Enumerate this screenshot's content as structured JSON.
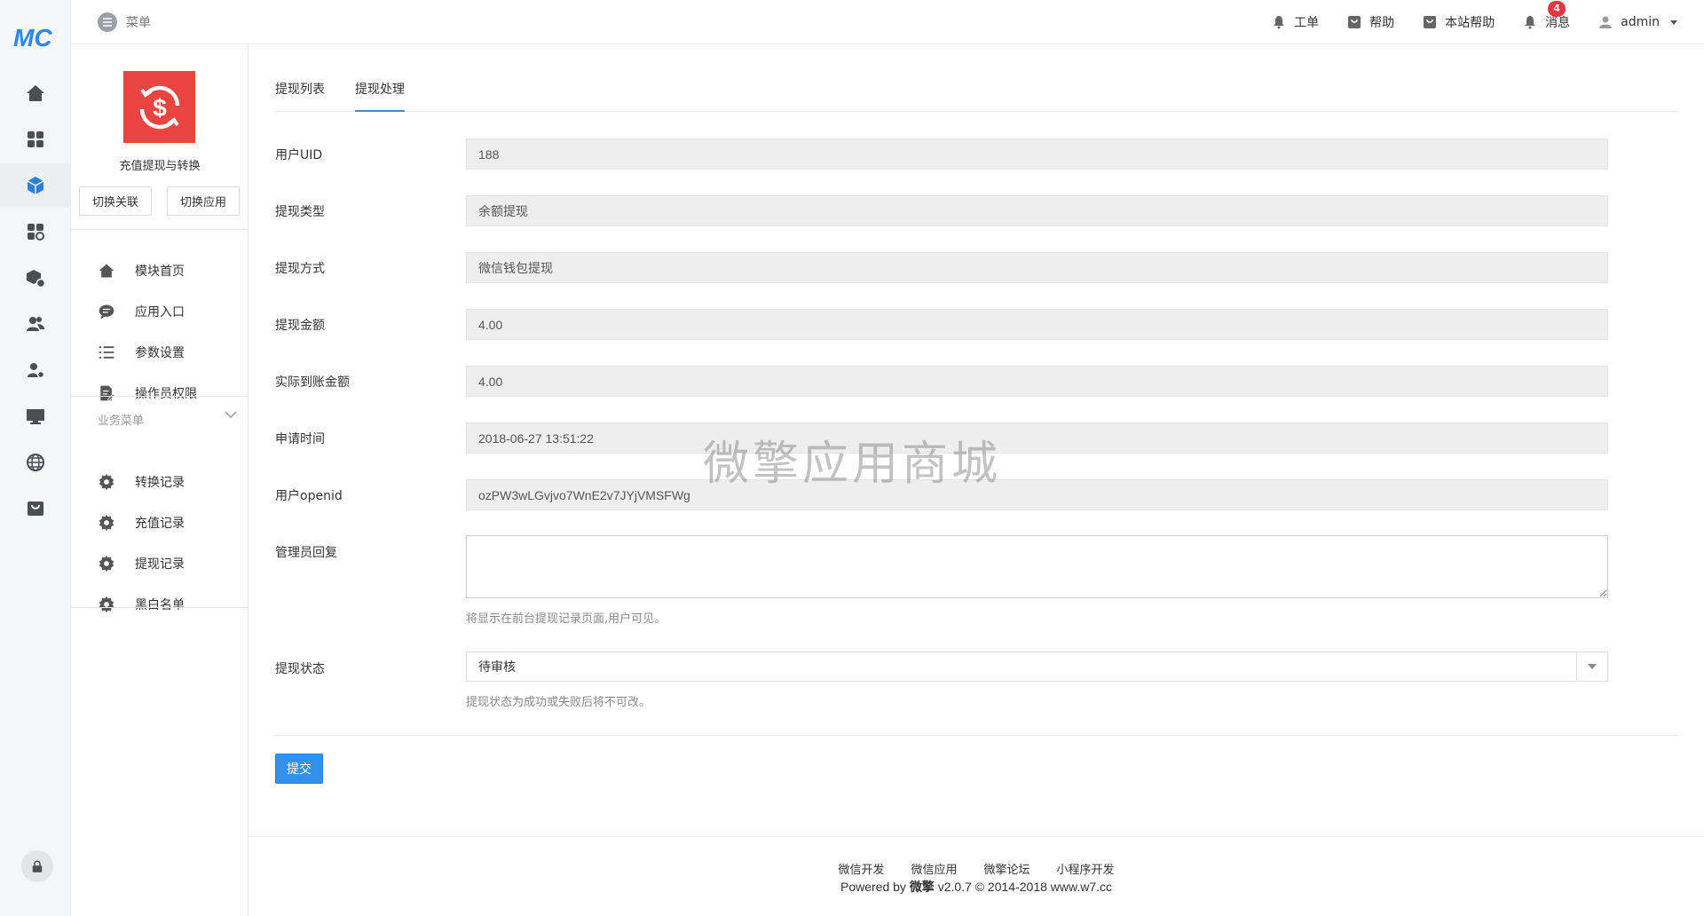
{
  "topbar": {
    "menu_label": "菜单",
    "links": [
      {
        "label": "工单",
        "icon": "bell-icon"
      },
      {
        "label": "帮助",
        "icon": "help-box-icon"
      },
      {
        "label": "本站帮助",
        "icon": "help-box-icon"
      },
      {
        "label": "消息",
        "icon": "bell-icon",
        "badge": "4"
      }
    ],
    "user": "admin"
  },
  "rail": {
    "items": [
      "home-icon",
      "grid-icon",
      "cube-icon",
      "apps-icon",
      "cube-gear-icon",
      "users-icon",
      "user-gear-icon",
      "monitor-icon",
      "globe-icon",
      "shop-icon"
    ],
    "active_index": 2
  },
  "sidebar": {
    "app_name": "充值提现与转换",
    "switch_link": "切换关联",
    "switch_app": "切换应用",
    "items": [
      {
        "label": "模块首页",
        "icon": "home-icon"
      },
      {
        "label": "应用入口",
        "icon": "chat-icon"
      },
      {
        "label": "参数设置",
        "icon": "list-icon"
      },
      {
        "label": "操作员权限",
        "icon": "edit-doc-icon"
      }
    ],
    "group_label": "业务菜单",
    "group_items": [
      {
        "label": "转换记录",
        "icon": "gear-icon"
      },
      {
        "label": "充值记录",
        "icon": "gear-icon"
      },
      {
        "label": "提现记录",
        "icon": "gear-icon"
      },
      {
        "label": "黑白名单",
        "icon": "gear-icon"
      }
    ]
  },
  "tabs": [
    {
      "label": "提现列表",
      "active": false
    },
    {
      "label": "提现处理",
      "active": true
    }
  ],
  "form": {
    "fields": [
      {
        "label": "用户UID",
        "value": "188"
      },
      {
        "label": "提现类型",
        "value": "余额提现"
      },
      {
        "label": "提现方式",
        "value": "微信钱包提现"
      },
      {
        "label": "提现金额",
        "value": "4.00"
      },
      {
        "label": "实际到账金额",
        "value": "4.00"
      },
      {
        "label": "申请时间",
        "value": "2018-06-27 13:51:22"
      },
      {
        "label": "用户openid",
        "value": "ozPW3wLGvjvo7WnE2v7JYjVMSFWg"
      }
    ],
    "reply_label": "管理员回复",
    "reply_value": "",
    "reply_help": "将显示在前台提现记录页面,用户可见。",
    "status_label": "提现状态",
    "status_value": "待审核",
    "status_help": "提现状态为成功或失败后将不可改。",
    "submit": "提交"
  },
  "watermark": "微擎应用商城",
  "footer": {
    "links": [
      "微信开发",
      "微信应用",
      "微擎论坛",
      "小程序开发"
    ],
    "powered_prefix": "Powered by",
    "brand": "微擎",
    "powered_suffix": "v2.0.7 © 2014-2018 www.w7.cc"
  },
  "colors": {
    "accent": "#428bca",
    "primary_button": "#3390ec",
    "app_icon": "#e9443f",
    "badge": "#e4393c",
    "rail_icon": "#2f7fd6"
  }
}
